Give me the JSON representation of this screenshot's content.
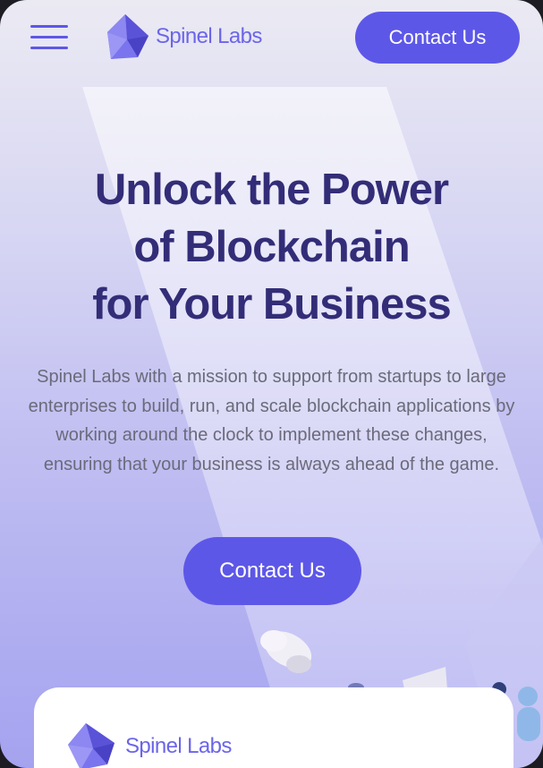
{
  "header": {
    "menu_icon": "hamburger-menu-icon",
    "logo_text": "Spinel Labs",
    "contact_label": "Contact Us"
  },
  "hero": {
    "title_line1": "Unlock the Power",
    "title_line2": "of Blockchain",
    "title_line3": "for Your Business",
    "description": "Spinel Labs with a mission to support from startups to large enterprises to build, run, and scale blockchain applications by working around the clock to implement these changes, ensuring that your business is always ahead of the game.",
    "contact_label": "Contact Us"
  },
  "card": {
    "logo_text": "Spinel Labs"
  },
  "colors": {
    "accent": "#5d57e8",
    "title": "#332d78",
    "logo": "#6b65e9",
    "body_text": "#6a6a7a"
  }
}
